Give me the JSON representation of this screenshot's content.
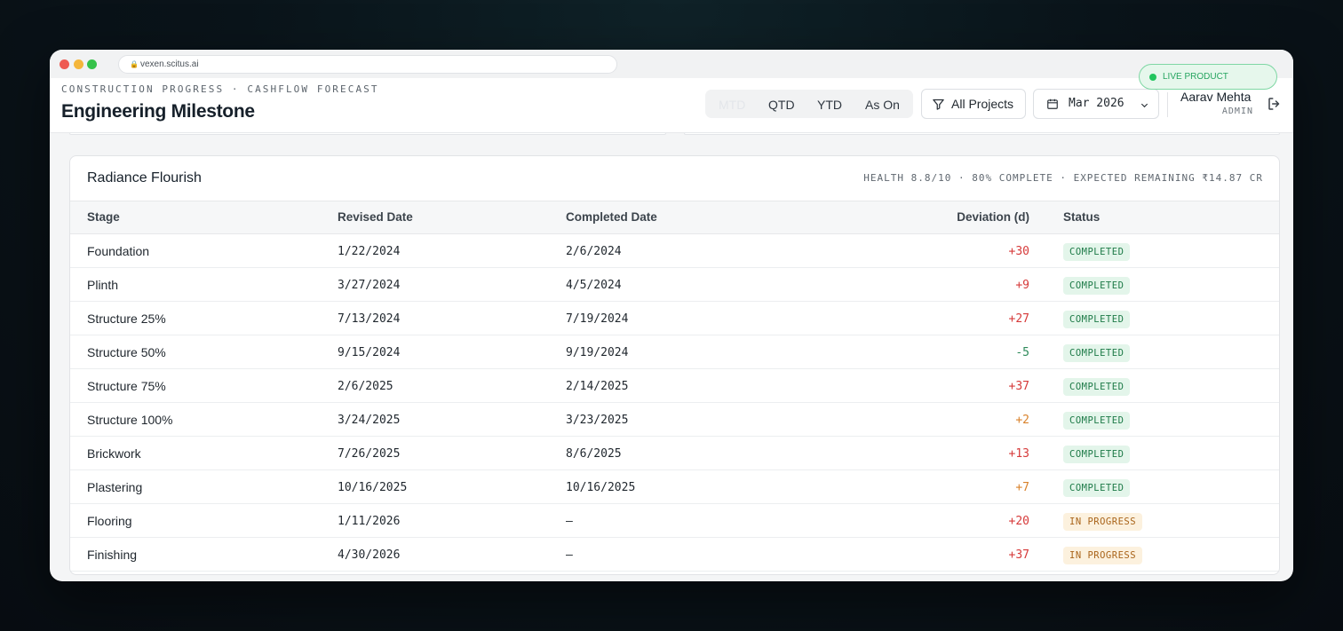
{
  "browser": {
    "url": "vexen.scitus.ai"
  },
  "live_badge": {
    "label": "LIVE PRODUCT"
  },
  "header": {
    "eyebrow": "CONSTRUCTION PROGRESS · CASHFLOW FORECAST",
    "title": "Engineering Milestone",
    "periods": [
      "MTD",
      "QTD",
      "YTD",
      "As On"
    ],
    "active_period": "MTD",
    "filter_label": "All Projects",
    "date_label": "Mar 2026",
    "user": {
      "name": "Aarav Mehta",
      "role": "ADMIN"
    }
  },
  "card": {
    "title": "Radiance Flourish",
    "meta": "HEALTH 8.8/10 · 80% COMPLETE · EXPECTED REMAINING ₹14.87 CR",
    "columns": [
      "Stage",
      "Revised Date",
      "Completed Date",
      "Deviation (d)",
      "Status"
    ],
    "rows": [
      {
        "stage": "Foundation",
        "revised": "1/22/2024",
        "completed": "2/6/2024",
        "deviation": "+30",
        "status": "COMPLETED"
      },
      {
        "stage": "Plinth",
        "revised": "3/27/2024",
        "completed": "4/5/2024",
        "deviation": "+9",
        "status": "COMPLETED"
      },
      {
        "stage": "Structure 25%",
        "revised": "7/13/2024",
        "completed": "7/19/2024",
        "deviation": "+27",
        "status": "COMPLETED"
      },
      {
        "stage": "Structure 50%",
        "revised": "9/15/2024",
        "completed": "9/19/2024",
        "deviation": "-5",
        "status": "COMPLETED"
      },
      {
        "stage": "Structure 75%",
        "revised": "2/6/2025",
        "completed": "2/14/2025",
        "deviation": "+37",
        "status": "COMPLETED"
      },
      {
        "stage": "Structure 100%",
        "revised": "3/24/2025",
        "completed": "3/23/2025",
        "deviation": "+2",
        "status": "COMPLETED"
      },
      {
        "stage": "Brickwork",
        "revised": "7/26/2025",
        "completed": "8/6/2025",
        "deviation": "+13",
        "status": "COMPLETED"
      },
      {
        "stage": "Plastering",
        "revised": "10/16/2025",
        "completed": "10/16/2025",
        "deviation": "+7",
        "status": "COMPLETED"
      },
      {
        "stage": "Flooring",
        "revised": "1/11/2026",
        "completed": "—",
        "deviation": "+20",
        "status": "IN PROGRESS"
      },
      {
        "stage": "Finishing",
        "revised": "4/30/2026",
        "completed": "—",
        "deviation": "+37",
        "status": "IN PROGRESS"
      }
    ]
  },
  "colors": {
    "deviation_late": "#d63a3a",
    "deviation_early": "#2e8a5a",
    "deviation_minor": "#d9822b",
    "status_completed": "#1d7a47",
    "status_in_progress": "#a9641a",
    "live": "#22c55e"
  }
}
